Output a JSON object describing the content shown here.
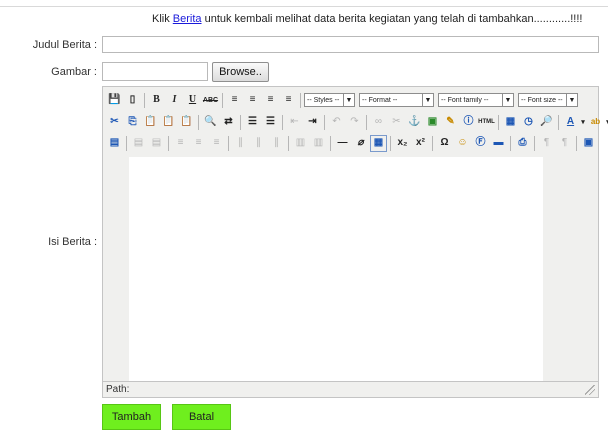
{
  "notice": {
    "prefix": "Klik ",
    "link": "Berita",
    "suffix": " untuk kembali melihat data berita kegiatan yang telah di tambahkan............!!!!"
  },
  "form": {
    "judul_label": "Judul Berita :",
    "judul_value": "",
    "gambar_label": "Gambar :",
    "browse_label": "Browse..",
    "isi_label": "Isi Berita :"
  },
  "editor": {
    "selects": {
      "styles": "-- Styles --",
      "format": "-- Format --",
      "font_family": "-- Font family --",
      "font_size": "-- Font size --"
    },
    "path_label": "Path:"
  },
  "buttons": {
    "tambah": "Tambah",
    "batal": "Batal"
  }
}
